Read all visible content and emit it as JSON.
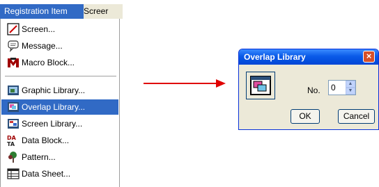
{
  "menubar": {
    "active_label": "Registration Item",
    "next_label": "Screer"
  },
  "menu": {
    "items": [
      {
        "label": "Screen...",
        "icon": "screen-icon"
      },
      {
        "label": "Message...",
        "icon": "message-icon"
      },
      {
        "label": "Macro Block...",
        "icon": "macro-block-icon"
      },
      {
        "label": "Graphic Library...",
        "icon": "graphic-library-icon"
      },
      {
        "label": "Overlap Library...",
        "icon": "overlap-library-icon",
        "selected": true
      },
      {
        "label": "Screen Library...",
        "icon": "screen-library-icon"
      },
      {
        "label": "Data Block...",
        "icon": "data-block-icon"
      },
      {
        "label": "Pattern...",
        "icon": "pattern-icon"
      },
      {
        "label": "Data Sheet...",
        "icon": "data-sheet-icon"
      }
    ]
  },
  "dialog": {
    "title": "Overlap Library",
    "close_label": "×",
    "no_label": "No.",
    "no_value": "0",
    "ok_label": "OK",
    "cancel_label": "Cancel"
  },
  "colors": {
    "selection": "#316ac5",
    "arrow": "#e00000",
    "titlebar": "#0a5ae8"
  }
}
